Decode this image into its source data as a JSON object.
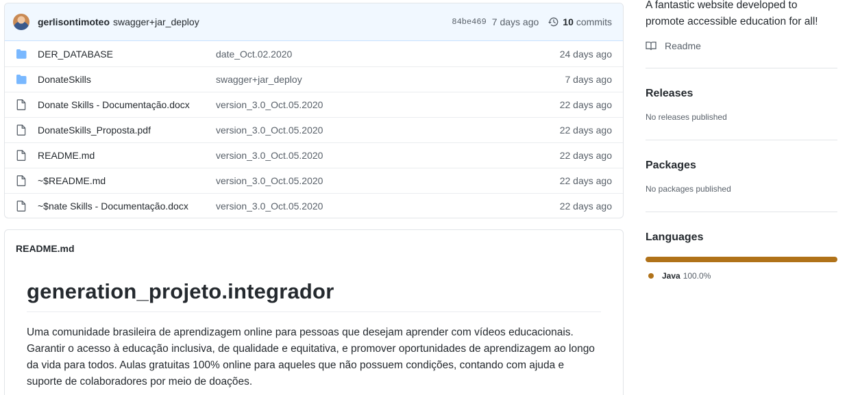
{
  "commit": {
    "author": "gerlisontimoteo",
    "message": "swagger+jar_deploy",
    "sha": "84be469",
    "date": "7 days ago",
    "commit_count": "10",
    "commit_label": "commits"
  },
  "files": [
    {
      "type": "folder",
      "name": "DER_DATABASE",
      "message": "date_Oct.02.2020",
      "age": "24 days ago"
    },
    {
      "type": "folder",
      "name": "DonateSkills",
      "message": "swagger+jar_deploy",
      "age": "7 days ago"
    },
    {
      "type": "file",
      "name": "Donate Skills - Documentação.docx",
      "message": "version_3.0_Oct.05.2020",
      "age": "22 days ago"
    },
    {
      "type": "file",
      "name": "DonateSkills_Proposta.pdf",
      "message": "version_3.0_Oct.05.2020",
      "age": "22 days ago"
    },
    {
      "type": "file",
      "name": "README.md",
      "message": "version_3.0_Oct.05.2020",
      "age": "22 days ago"
    },
    {
      "type": "file",
      "name": "~$README.md",
      "message": "version_3.0_Oct.05.2020",
      "age": "22 days ago"
    },
    {
      "type": "file",
      "name": "~$nate Skills - Documentação.docx",
      "message": "version_3.0_Oct.05.2020",
      "age": "22 days ago"
    }
  ],
  "readme": {
    "header": "README.md",
    "title": "generation_projeto.integrador",
    "body": "Uma comunidade brasileira de aprendizagem online para pessoas que desejam aprender com vídeos educacionais. Garantir o acesso à educação inclusiva, de qualidade e equitativa, e promover oportunidades de aprendizagem ao longo da vida para todos. Aulas gratuitas 100% online para aqueles que não possuem condições, contando com ajuda e suporte de colaboradores por meio de doações."
  },
  "sidebar": {
    "about": "A fantastic website developed to promote accessible education for all!",
    "readme_link": "Readme",
    "releases": {
      "title": "Releases",
      "sub": "No releases published"
    },
    "packages": {
      "title": "Packages",
      "sub": "No packages published"
    },
    "languages": {
      "title": "Languages",
      "items": [
        {
          "name": "Java",
          "percent": "100.0%",
          "color": "#b07219",
          "fraction": 1.0
        }
      ]
    }
  },
  "icons": {
    "folder": "folder-icon",
    "file": "file-icon",
    "history": "history-icon",
    "book": "book-icon"
  },
  "colors": {
    "folder": "#79b8ff",
    "commit_bar": "#f1f8ff"
  }
}
